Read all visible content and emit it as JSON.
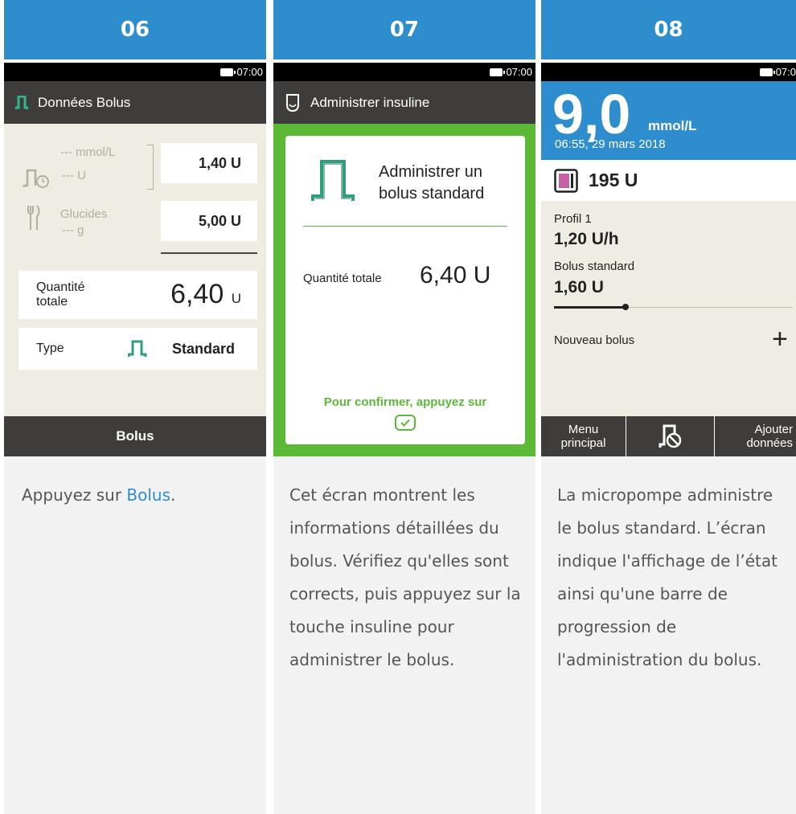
{
  "col1": {
    "step": "06",
    "time": "07:00",
    "title": "Données Bolus",
    "bg_unit": "--- mmol/L",
    "insulin_placeholder": "--- U",
    "carbs_label": "Glucides",
    "carbs_placeholder": "--- g",
    "correction_value": "1,40 U",
    "carbs_value": "5,00 U",
    "total_label_1": "Quantité",
    "total_label_2": "totale",
    "total_value": "6,40",
    "total_unit": "U",
    "type_label": "Type",
    "type_value": "Standard",
    "button": "Bolus",
    "desc_prefix": "Appuyez sur ",
    "desc_link": "Bolus",
    "desc_suffix": "."
  },
  "col2": {
    "step": "07",
    "time": "07:00",
    "title": "Administrer insuline",
    "card_title_1": "Administrer un",
    "card_title_2": "bolus standard",
    "total_label": "Quantité totale",
    "total_value": "6,40 U",
    "confirm": "Pour confirmer, appuyez sur",
    "desc": "Cet écran montrent les informations détaillées du bolus. Vérifiez qu'elles sont corrects, puis appuyez sur la touche insuline pour administrer le bolus."
  },
  "col3": {
    "step": "08",
    "time": "07:0",
    "bg_value": "9,0",
    "bg_unit": "mmol/L",
    "bg_time": "06:55, 29 mars 2018",
    "reservoir": "195 U",
    "profile": "Profil 1",
    "rate": "1,20 U/h",
    "bolus_type": "Bolus standard",
    "bolus_amount": "1,60 U",
    "progress": 0.3,
    "new_bolus": "Nouveau bolus",
    "menu_1": "Menu",
    "menu_2": "principal",
    "add_1": "Ajouter",
    "add_2": "données",
    "desc": "La micropompe administre le bolus standard. L’écran indique l'affichage de l’état ainsi qu'une barre de progression de l'administration du bolus."
  },
  "colors": {
    "header": "#2e8dcc",
    "green": "#5cb935",
    "teal": "#2e9e7e",
    "bg_blue": "#2e8dcc"
  }
}
